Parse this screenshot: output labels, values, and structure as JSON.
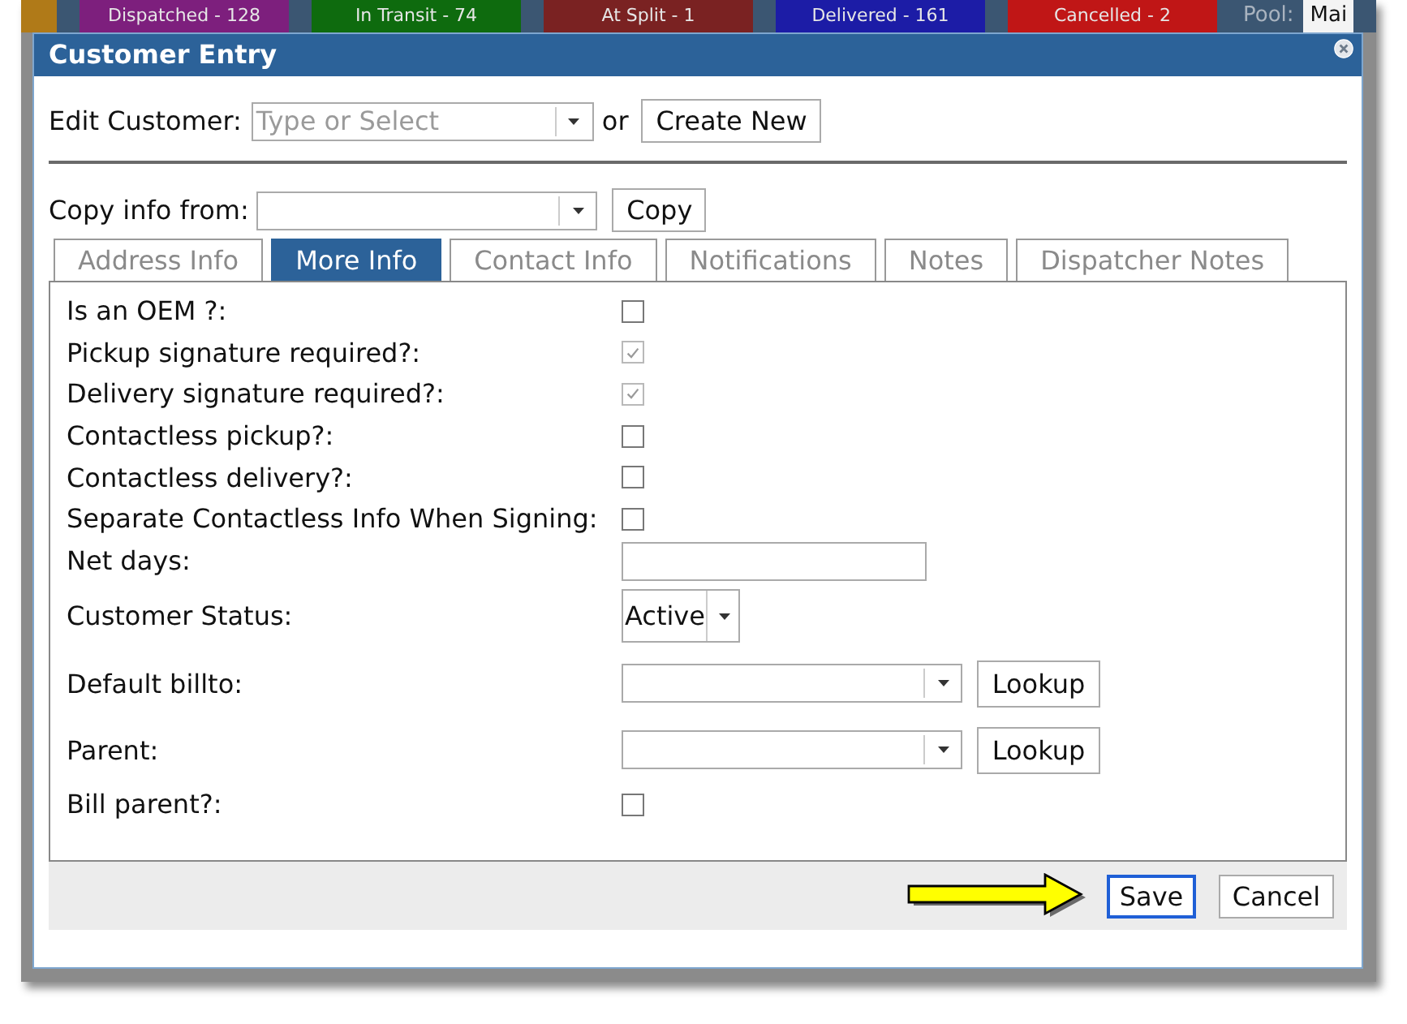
{
  "background_bar": {
    "items": [
      {
        "color": "#b07a18"
      },
      {
        "label": "Dispatched - 128",
        "color": "#7d1f7d"
      },
      {
        "label": "In Transit - 74",
        "color": "#0e6b0e"
      },
      {
        "label": "At Split - 1",
        "color": "#7a2222"
      },
      {
        "label": "Delivered - 161",
        "color": "#1c1ca6"
      },
      {
        "label": "Cancelled - 2",
        "color": "#c01616"
      }
    ],
    "pool_label": "Pool:",
    "pool_value": "Mai"
  },
  "dialog": {
    "title": "Customer Entry"
  },
  "edit_customer": {
    "label": "Edit Customer:",
    "placeholder": "Type or Select",
    "separator": "or",
    "button": "Create New"
  },
  "copy_info": {
    "label": "Copy info from:",
    "button": "Copy"
  },
  "tabs": [
    {
      "label": "Address Info",
      "selected": false
    },
    {
      "label": "More Info",
      "selected": true
    },
    {
      "label": "Contact Info",
      "selected": false
    },
    {
      "label": "Notifications",
      "selected": false
    },
    {
      "label": "Notes",
      "selected": false
    },
    {
      "label": "Dispatcher Notes",
      "selected": false
    }
  ],
  "form": {
    "rows": [
      {
        "kind": "checkbox",
        "label": "Is an OEM ?:",
        "checked": false,
        "disabled": false
      },
      {
        "kind": "checkbox",
        "label": "Pickup signature required?:",
        "checked": true,
        "disabled": true
      },
      {
        "kind": "checkbox",
        "label": "Delivery signature required?:",
        "checked": true,
        "disabled": true
      },
      {
        "kind": "checkbox",
        "label": "Contactless pickup?:",
        "checked": false,
        "disabled": false
      },
      {
        "kind": "checkbox",
        "label": "Contactless delivery?:",
        "checked": false,
        "disabled": false
      },
      {
        "kind": "checkbox",
        "label": "Separate Contactless Info When Signing:",
        "checked": false,
        "disabled": false
      },
      {
        "kind": "text",
        "label": "Net days:"
      },
      {
        "kind": "select",
        "label": "Customer Status:",
        "value": "Active"
      },
      {
        "kind": "lookup",
        "label": "Default billto:",
        "button": "Lookup"
      },
      {
        "kind": "lookup",
        "label": "Parent:",
        "button": "Lookup"
      },
      {
        "kind": "checkbox",
        "label": "Bill parent?:",
        "checked": false,
        "disabled": false
      }
    ]
  },
  "footer": {
    "buttons": [
      {
        "label": "Save",
        "focused": true
      },
      {
        "label": "Cancel",
        "focused": false
      }
    ]
  }
}
